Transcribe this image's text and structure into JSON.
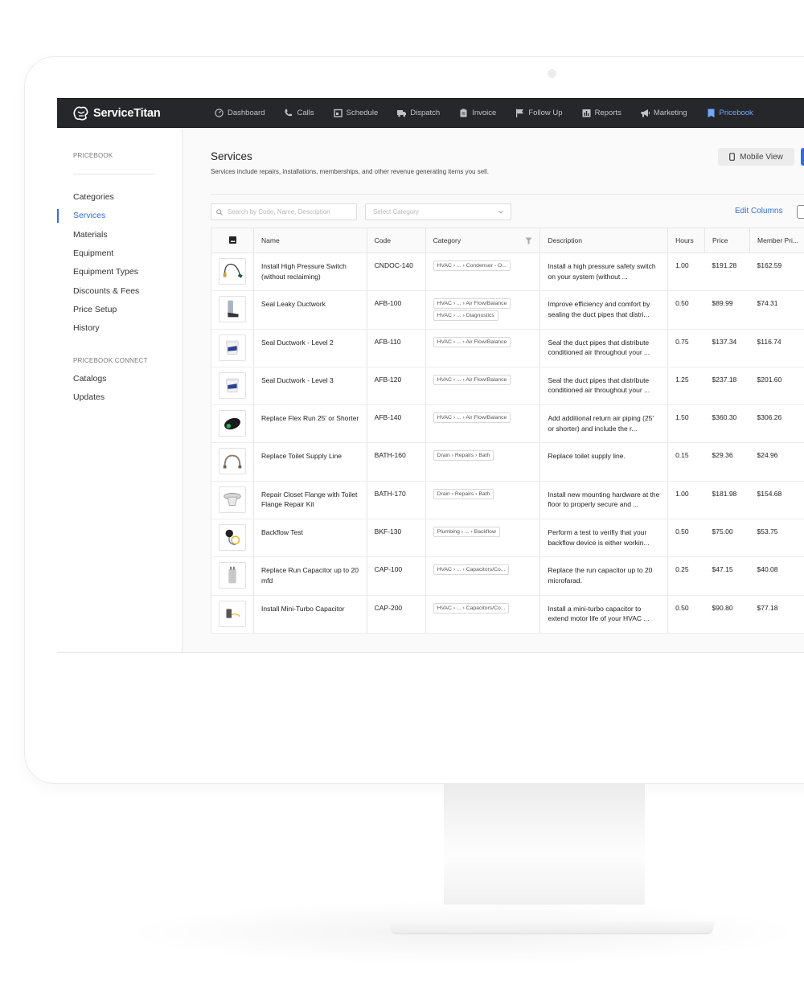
{
  "brand": {
    "name": "ServiceTitan",
    "accent": "#2f6fdf",
    "nav_bg": "#26272b"
  },
  "nav": [
    {
      "label": "Dashboard",
      "icon": "dashboard-gauge-icon"
    },
    {
      "label": "Calls",
      "icon": "phone-icon"
    },
    {
      "label": "Schedule",
      "icon": "calendar-icon"
    },
    {
      "label": "Dispatch",
      "icon": "truck-icon"
    },
    {
      "label": "Invoice",
      "icon": "clipboard-icon"
    },
    {
      "label": "Follow Up",
      "icon": "flag-icon"
    },
    {
      "label": "Reports",
      "icon": "bar-chart-icon"
    },
    {
      "label": "Marketing",
      "icon": "megaphone-icon"
    },
    {
      "label": "Pricebook",
      "icon": "book-icon",
      "active": true
    }
  ],
  "sidebar": {
    "heading": "PRICEBOOK",
    "items": [
      "Categories",
      "Services",
      "Materials",
      "Equipment",
      "Equipment Types",
      "Discounts & Fees",
      "Price Setup",
      "History"
    ],
    "active": "Services",
    "connect_heading": "PRICEBOOK CONNECT",
    "connect_items": [
      "Catalogs",
      "Updates"
    ]
  },
  "page": {
    "title": "Services",
    "subtitle": "Services include repairs, installations, memberships, and other revenue generating items you sell.",
    "mobile_view_label": "Mobile View",
    "search_placeholder": "Search by Code, Name, Description",
    "category_placeholder": "Select Category",
    "edit_columns_label": "Edit Columns"
  },
  "table": {
    "columns": [
      "Name",
      "Code",
      "Category",
      "Description",
      "Hours",
      "Price",
      "Member Pri..."
    ],
    "rows": [
      {
        "thumb": "pressure-switch",
        "name": "Install High Pressure Switch (without reclaiming)",
        "code": "CNDOC-140",
        "categories": [
          "HVAC  ›  ...  ›  Condenser - O..."
        ],
        "description": "Install a high pressure safety switch on your system (without ...",
        "hours": "1.00",
        "price": "$191.28",
        "member_price": "$162.59"
      },
      {
        "thumb": "ductwork-tool",
        "name": "Seal Leaky Ductwork",
        "code": "AFB-100",
        "categories": [
          "HVAC  ›  ...  ›  Air Flow/Balance",
          "HVAC  ›  ...  ›  Diagnostics"
        ],
        "description": "Improve efficiency and comfort by sealing the duct pipes that distri...",
        "hours": "0.50",
        "price": "$89.99",
        "member_price": "$74.31"
      },
      {
        "thumb": "sealant-bucket",
        "name": "Seal Ductwork - Level 2",
        "code": "AFB-110",
        "categories": [
          "HVAC  ›  ...  ›  Air Flow/Balance"
        ],
        "description": "Seal the duct pipes that distribute conditioned air throughout your ...",
        "hours": "0.75",
        "price": "$137.34",
        "member_price": "$116.74"
      },
      {
        "thumb": "sealant-bucket",
        "name": "Seal Ductwork - Level 3",
        "code": "AFB-120",
        "categories": [
          "HVAC  ›  ...  ›  Air Flow/Balance"
        ],
        "description": "Seal the duct pipes that distribute conditioned air throughout your ...",
        "hours": "1.25",
        "price": "$237.18",
        "member_price": "$201.60"
      },
      {
        "thumb": "flex-duct",
        "name": "Replace Flex Run 25' or Shorter",
        "code": "AFB-140",
        "categories": [
          "HVAC  ›  ...  ›  Air Flow/Balance"
        ],
        "description": "Add additional return air piping (25' or shorter) and include the r...",
        "hours": "1.50",
        "price": "$360.30",
        "member_price": "$306.26"
      },
      {
        "thumb": "supply-line",
        "name": "Replace Toilet Supply Line",
        "code": "BATH-160",
        "categories": [
          "Drain  ›  Repairs  ›  Bath"
        ],
        "description": "Replace toilet supply line.",
        "hours": "0.15",
        "price": "$29.36",
        "member_price": "$24.96"
      },
      {
        "thumb": "closet-flange",
        "name": "Repair Closet Flange with Toilet Flange Repair Kit",
        "code": "BATH-170",
        "categories": [
          "Drain  ›  Repairs  ›  Bath"
        ],
        "description": "Install new mounting hardware at the floor to properly secure and ...",
        "hours": "1.00",
        "price": "$181.98",
        "member_price": "$154.68"
      },
      {
        "thumb": "backflow-gauge",
        "name": "Backflow Test",
        "code": "BKF-130",
        "categories": [
          "Plumbing  ›  ...  ›  Backflow"
        ],
        "description": "Perform a test to verifiy that your backflow device is either workin...",
        "hours": "0.50",
        "price": "$75.00",
        "member_price": "$53.75"
      },
      {
        "thumb": "run-capacitor",
        "name": "Replace Run Capacitor up to 20 mfd",
        "code": "CAP-100",
        "categories": [
          "HVAC  ›  ...  ›  Capacitors/Co..."
        ],
        "description": "Replace the run capacitor up to 20 microfarad.",
        "hours": "0.25",
        "price": "$47.15",
        "member_price": "$40.08"
      },
      {
        "thumb": "mini-capacitor",
        "name": "Install Mini-Turbo Capacitor",
        "code": "CAP-200",
        "categories": [
          "HVAC  ›  ...  ›  Capacitors/Co..."
        ],
        "description": "Install a mini-turbo capacitor to extend motor life of your HVAC ...",
        "hours": "0.50",
        "price": "$90.80",
        "member_price": "$77.18"
      }
    ]
  }
}
